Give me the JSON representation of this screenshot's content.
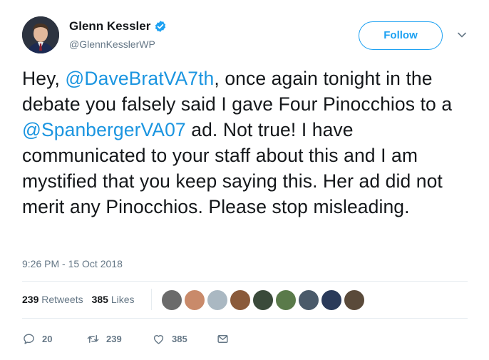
{
  "author": {
    "name": "Glenn Kessler",
    "handle": "@GlennKesslerWP"
  },
  "follow_label": "Follow",
  "tweet": {
    "segments": [
      {
        "text": "Hey, ",
        "type": "text"
      },
      {
        "text": "@DaveBratVA7th",
        "type": "mention"
      },
      {
        "text": ", once again tonight in the debate you falsely said I gave Four Pinocchios to a ",
        "type": "text"
      },
      {
        "text": "@SpanbergerVA07",
        "type": "mention"
      },
      {
        "text": " ad. Not true! I have communicated to your staff about this and I am mystified that you keep saying this. Her ad did not merit any Pinocchios. Please stop misleading.",
        "type": "text"
      }
    ],
    "timestamp": "9:26 PM - 15 Oct 2018"
  },
  "stats": {
    "retweets_count": "239",
    "retweets_label": "Retweets",
    "likes_count": "385",
    "likes_label": "Likes"
  },
  "liker_avatars": [
    "#6b6b6b",
    "#c98a6a",
    "#aab8c2",
    "#8a5a3a",
    "#3a4a3a",
    "#5a7a4a",
    "#4a5a6a",
    "#2a3a5a",
    "#5a4a3a"
  ],
  "actions": {
    "reply_count": "20",
    "retweet_count": "239",
    "like_count": "385"
  },
  "colors": {
    "accent": "#1da1f2",
    "mention": "#1b95e0",
    "muted": "#657786",
    "text": "#14171a"
  }
}
